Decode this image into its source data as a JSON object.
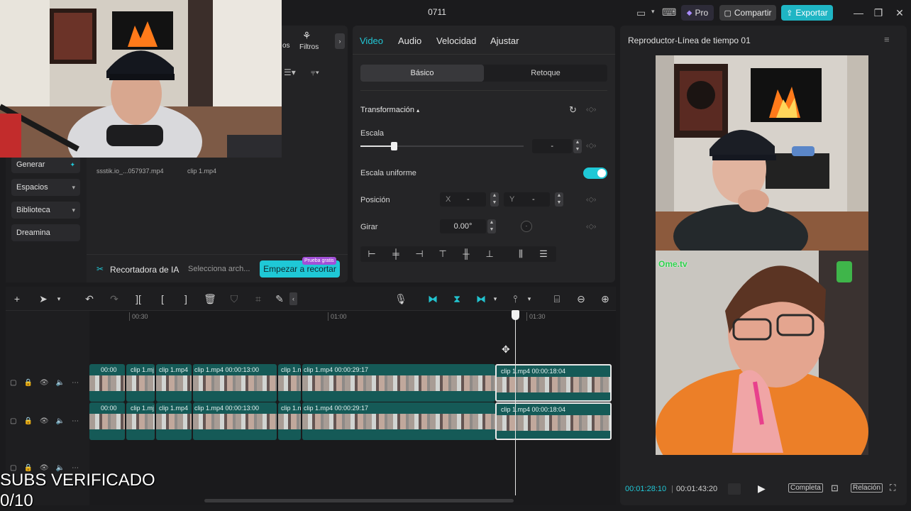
{
  "app": {
    "title": "0711",
    "pro_label": "Pro",
    "share_label": "Compartir",
    "export_label": "Exportar"
  },
  "media_panel": {
    "tab_filtros": "Filtros",
    "tab_partial": "os",
    "sidebar": [
      "Generar",
      "Espacios",
      "Biblioteca",
      "Dreamina"
    ],
    "files": [
      "ssstik.io_...057937.mp4",
      "clip 1.mp4"
    ],
    "ai_cutout_label": "Recortadora de IA",
    "select_file_label": "Selecciona arch...",
    "start_cutout_button": "Empezar a recortar",
    "free_trial_badge": "Prueba gratis"
  },
  "properties": {
    "tabs": [
      "Video",
      "Audio",
      "Velocidad",
      "Ajustar"
    ],
    "subtabs": [
      "Básico",
      "Retoque"
    ],
    "transform_label": "Transformación",
    "scale_label": "Escala",
    "scale_value": "-",
    "uniform_scale_label": "Escala uniforme",
    "position_label": "Posición",
    "x_label": "X",
    "x_value": "-",
    "y_label": "Y",
    "y_value": "-",
    "rotate_label": "Girar",
    "rotate_value": "0.00°"
  },
  "player": {
    "title": "Reproductor-Línea de tiempo 01",
    "watermark": "Ome.tv",
    "current_time": "00:01:28:10",
    "total_time": "00:01:43:20",
    "full_label": "Completa",
    "ratio_label": "Relación"
  },
  "timeline": {
    "ruler": [
      "00:30",
      "01:00",
      "01:30"
    ],
    "track1": [
      {
        "label": "00:00"
      },
      {
        "label": "clip 1.mj"
      },
      {
        "label": "clip 1.mp4"
      },
      {
        "label": "clip 1.mp4  00:00:13:00"
      },
      {
        "label": "clip 1.n"
      },
      {
        "label": "clip 1.mp4  00:00:29:17"
      },
      {
        "label": "clip 1.mp4  00:00:18:04"
      }
    ],
    "track2": [
      {
        "label": "00:00"
      },
      {
        "label": "clip 1.mj"
      },
      {
        "label": "clip 1.mp4"
      },
      {
        "label": "clip 1.mp4  00:00:13:00"
      },
      {
        "label": "clip 1.n"
      },
      {
        "label": "clip 1.mp4  00:00:29:17"
      },
      {
        "label": "clip 1.mp4  00:00:18:04"
      }
    ]
  },
  "overlay": {
    "line1": "SUBS VERIFICADO",
    "line2": "0/10"
  },
  "colors": {
    "accent": "#21c7d6",
    "export": "#1fb5c4",
    "clip": "#155a57"
  }
}
